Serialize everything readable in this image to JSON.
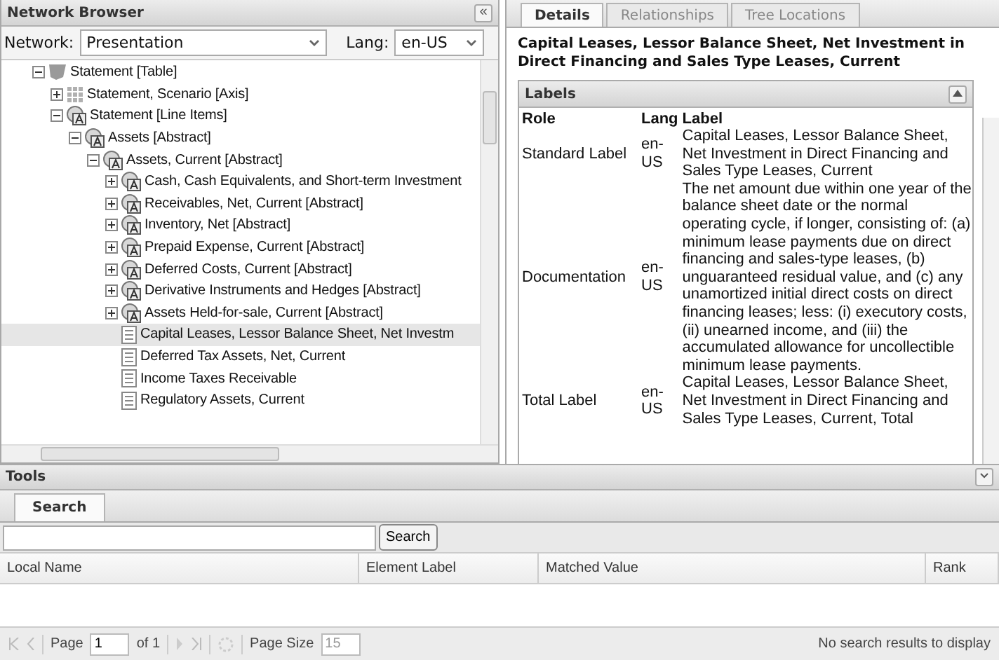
{
  "network_browser": {
    "title": "Network Browser",
    "collapse": "«",
    "network_label": "Network:",
    "network_value": "Presentation",
    "lang_label": "Lang:",
    "lang_value": "en-US",
    "tree": [
      {
        "label": "Statement [Table]",
        "kind": "table",
        "expanded": true,
        "selected": false,
        "children": [
          {
            "label": "Statement, Scenario [Axis]",
            "kind": "axis",
            "expanded": false,
            "selected": false
          },
          {
            "label": "Statement [Line Items]",
            "kind": "abstract",
            "expanded": true,
            "selected": false,
            "children": [
              {
                "label": "Assets [Abstract]",
                "kind": "abstract",
                "expanded": true,
                "selected": false,
                "children": [
                  {
                    "label": "Assets, Current [Abstract]",
                    "kind": "abstract",
                    "expanded": true,
                    "selected": false,
                    "children": [
                      {
                        "label": "Cash, Cash Equivalents, and Short-term Investment",
                        "kind": "abstract",
                        "expanded": false,
                        "selected": false
                      },
                      {
                        "label": "Receivables, Net, Current [Abstract]",
                        "kind": "abstract",
                        "expanded": false,
                        "selected": false
                      },
                      {
                        "label": "Inventory, Net [Abstract]",
                        "kind": "abstract",
                        "expanded": false,
                        "selected": false
                      },
                      {
                        "label": "Prepaid Expense, Current [Abstract]",
                        "kind": "abstract",
                        "expanded": false,
                        "selected": false
                      },
                      {
                        "label": "Deferred Costs, Current [Abstract]",
                        "kind": "abstract",
                        "expanded": false,
                        "selected": false
                      },
                      {
                        "label": "Derivative Instruments and Hedges [Abstract]",
                        "kind": "abstract",
                        "expanded": false,
                        "selected": false
                      },
                      {
                        "label": "Assets Held-for-sale, Current [Abstract]",
                        "kind": "abstract",
                        "expanded": false,
                        "selected": false
                      },
                      {
                        "label": "Capital Leases, Lessor Balance Sheet, Net Investm",
                        "kind": "item",
                        "selected": true
                      },
                      {
                        "label": "Deferred Tax Assets, Net, Current",
                        "kind": "item",
                        "selected": false
                      },
                      {
                        "label": "Income Taxes Receivable",
                        "kind": "item",
                        "selected": false
                      },
                      {
                        "label": "Regulatory Assets, Current",
                        "kind": "item",
                        "selected": false
                      }
                    ]
                  }
                ]
              }
            ]
          }
        ]
      }
    ]
  },
  "details": {
    "tabs": [
      {
        "label": "Details",
        "selected": true
      },
      {
        "label": "Relationships",
        "selected": false
      },
      {
        "label": "Tree Locations",
        "selected": false
      }
    ],
    "title": "Capital Leases, Lessor Balance Sheet, Net Investment in Direct Financing and Sales Type Leases, Current",
    "labels": {
      "title": "Labels",
      "columns": [
        "Role",
        "Lang",
        "Label"
      ],
      "rows": [
        {
          "role": "Standard Label",
          "lang": "en-US",
          "label": "Capital Leases, Lessor Balance Sheet, Net Investment in Direct Financing and Sales Type Leases, Current"
        },
        {
          "role": "Documentation",
          "lang": "en-US",
          "label": "The net amount due within one year of the balance sheet date or the normal operating cycle, if longer, consisting of: (a) minimum lease payments due on direct financing and sales-type leases, (b) unguaranteed residual value, and (c) any unamortized initial direct costs on direct financing leases; less: (i) executory costs, (ii) unearned income, and (iii) the accumulated allowance for uncollectible minimum lease payments."
        },
        {
          "role": "Total Label",
          "lang": "en-US",
          "label": "Capital Leases, Lessor Balance Sheet, Net Investment in Direct Financing and Sales Type Leases, Current, Total"
        }
      ]
    }
  },
  "tools": {
    "title": "Tools",
    "tabs": [
      {
        "label": "Search",
        "selected": true
      }
    ],
    "search_button": "Search",
    "columns": [
      "Local Name",
      "Element Label",
      "Matched Value",
      "Rank"
    ],
    "pager": {
      "page_label": "Page",
      "page": "1",
      "of": "of 1",
      "page_size_label": "Page Size",
      "page_size": "15",
      "status": "No search results to display"
    }
  }
}
